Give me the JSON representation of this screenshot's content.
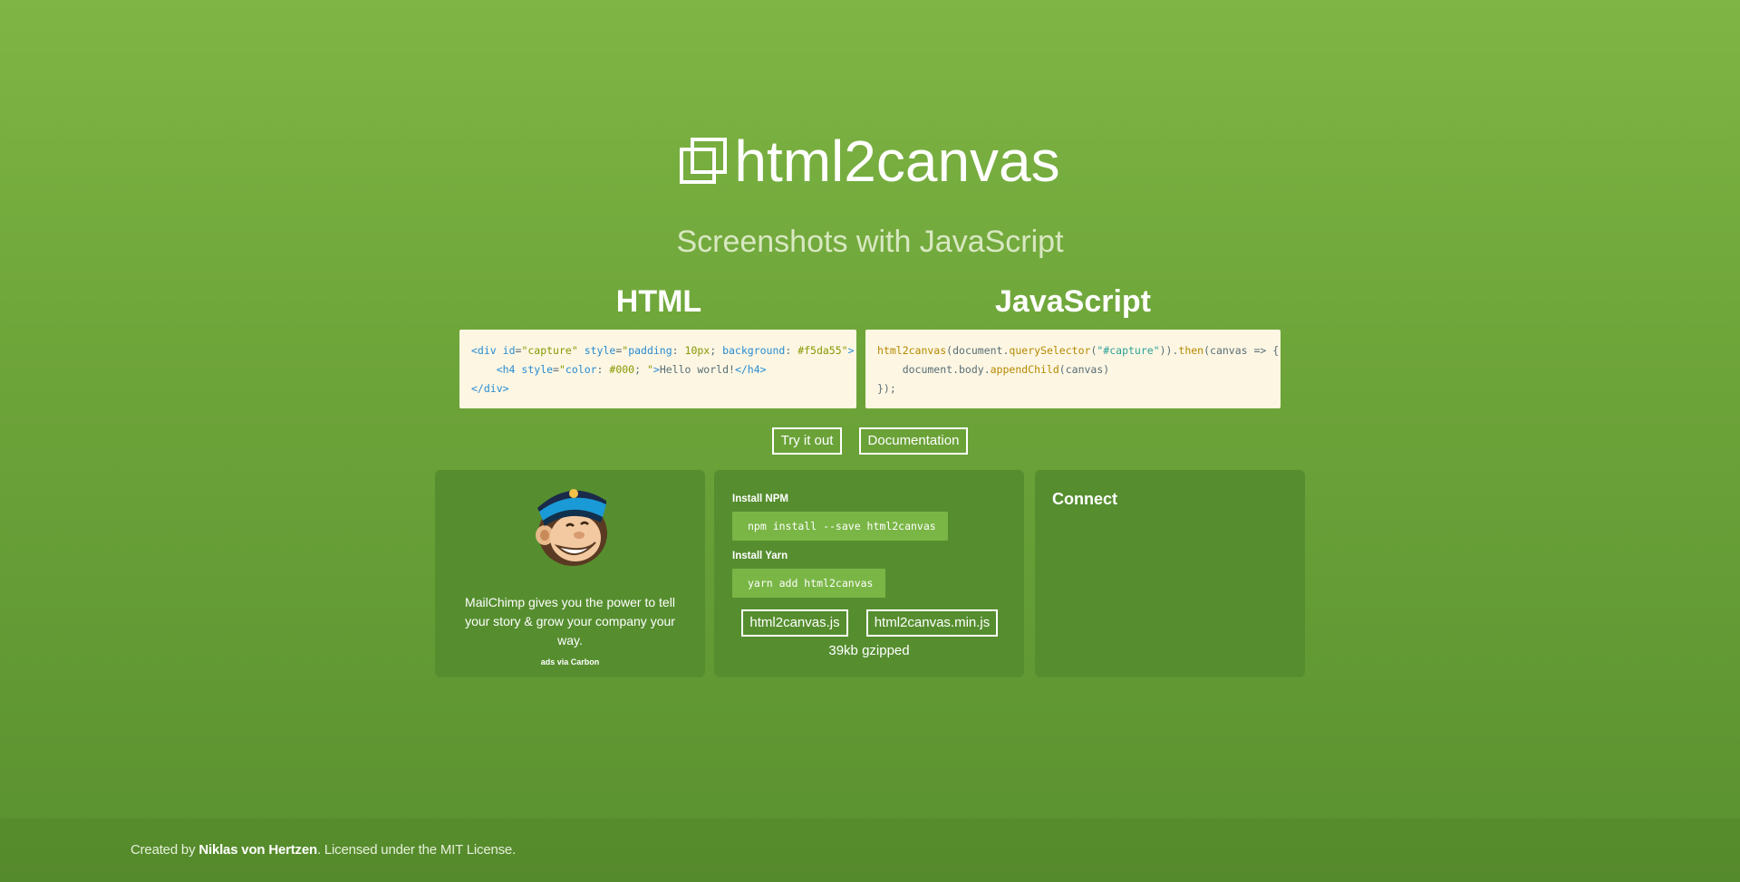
{
  "header": {
    "title": "html2canvas",
    "logo_icon": "stacked-squares-icon",
    "tagline": "Screenshots with JavaScript"
  },
  "examples": {
    "html": {
      "title": "HTML",
      "lines": [
        "<div id=\"capture\" style=\"padding: 10px; background: #f5da55\">",
        "    <h4 style=\"color: #000; \">Hello world!</h4>",
        "</div>"
      ]
    },
    "javascript": {
      "title": "JavaScript",
      "lines": [
        "html2canvas(document.querySelector(\"#capture\")).then(canvas => {",
        "    document.body.appendChild(canvas)",
        "});"
      ]
    }
  },
  "actions": {
    "try_label": "Try it out",
    "docs_label": "Documentation"
  },
  "ad": {
    "image_icon": "mailchimp-monkey-icon",
    "text": "MailChimp gives you the power to tell your story & grow your company your way.",
    "via": "ads via Carbon"
  },
  "install": {
    "npm_label": "Install NPM",
    "npm_cmd": "npm install --save html2canvas",
    "yarn_label": "Install Yarn",
    "yarn_cmd": "yarn add html2canvas",
    "download_full": "html2canvas.js",
    "download_min": "html2canvas.min.js",
    "size_note": "39kb gzipped"
  },
  "connect": {
    "title": "Connect"
  },
  "footer": {
    "prefix": "Created by ",
    "author": "Niklas von Hertzen",
    "suffix": ". Licensed under the MIT License."
  },
  "colors": {
    "background_top": "#7fb544",
    "background_bottom": "#5a9130",
    "panel": "#568e2f",
    "code_bg": "#fdf6e3",
    "command_bg": "#7ab646"
  }
}
